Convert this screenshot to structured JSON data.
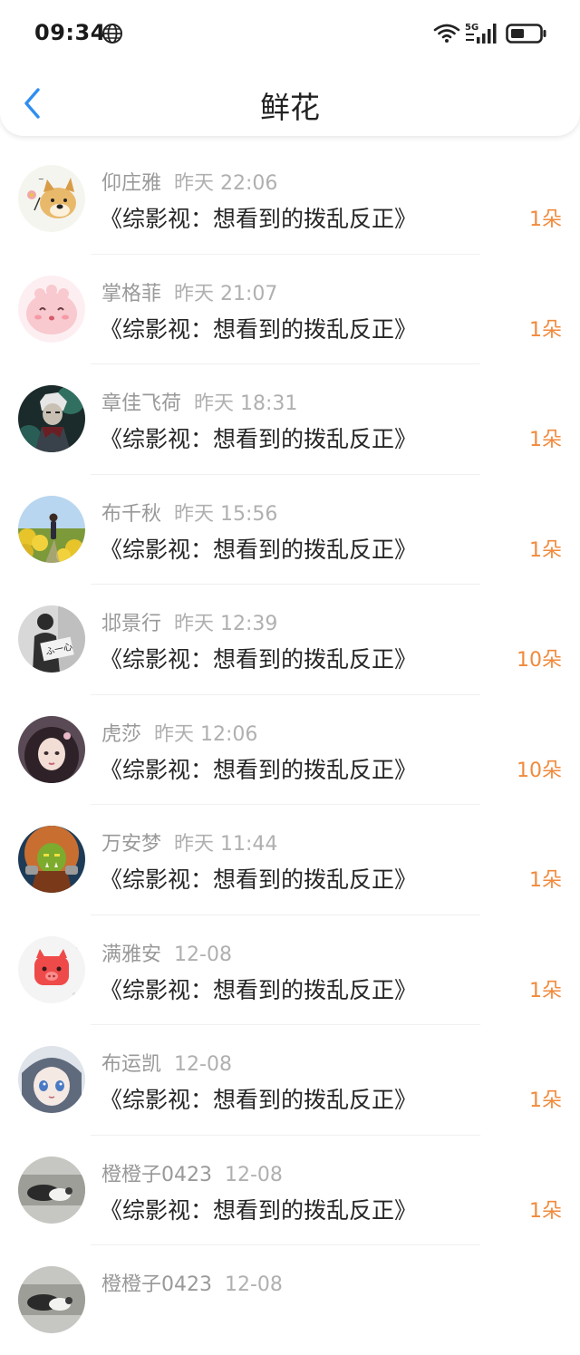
{
  "status_bar": {
    "time": "09:34",
    "network_label": "5G"
  },
  "header": {
    "title": "鲜花"
  },
  "colors": {
    "count": "#f08a3c",
    "back_arrow": "#2f8ef0",
    "name": "#999999"
  },
  "items": [
    {
      "name": "仰庄雅",
      "time": "昨天 22:06",
      "book": "《综影视：想看到的拨乱反正》",
      "count": "1朵",
      "avatar": "doge"
    },
    {
      "name": "掌格菲",
      "time": "昨天 21:07",
      "book": "《综影视：想看到的拨乱反正》",
      "count": "1朵",
      "avatar": "pink-blob"
    },
    {
      "name": "章佳飞荷",
      "time": "昨天 18:31",
      "book": "《综影视：想看到的拨乱反正》",
      "count": "1朵",
      "avatar": "game-character"
    },
    {
      "name": "布千秋",
      "time": "昨天 15:56",
      "book": "《综影视：想看到的拨乱反正》",
      "count": "1朵",
      "avatar": "flower-field"
    },
    {
      "name": "邶景行",
      "time": "昨天 12:39",
      "book": "《综影视：想看到的拨乱反正》",
      "count": "10朵",
      "avatar": "person-sign"
    },
    {
      "name": "虎莎",
      "time": "昨天 12:06",
      "book": "《综影视：想看到的拨乱反正》",
      "count": "10朵",
      "avatar": "girl"
    },
    {
      "name": "万安梦",
      "time": "昨天 11:44",
      "book": "《综影视：想看到的拨乱反正》",
      "count": "1朵",
      "avatar": "orc"
    },
    {
      "name": "满雅安",
      "time": "12-08",
      "book": "《综影视：想看到的拨乱反正》",
      "count": "1朵",
      "avatar": "red-pig"
    },
    {
      "name": "布运凯",
      "time": "12-08",
      "book": "《综影视：想看到的拨乱反正》",
      "count": "1朵",
      "avatar": "anime-girl"
    },
    {
      "name": "橙橙子0423",
      "time": "12-08",
      "book": "《综影视：想看到的拨乱反正》",
      "count": "1朵",
      "avatar": "cat-photo"
    },
    {
      "name": "橙橙子0423",
      "time": "12-08",
      "book": "",
      "count": "",
      "avatar": "cat-photo"
    }
  ]
}
